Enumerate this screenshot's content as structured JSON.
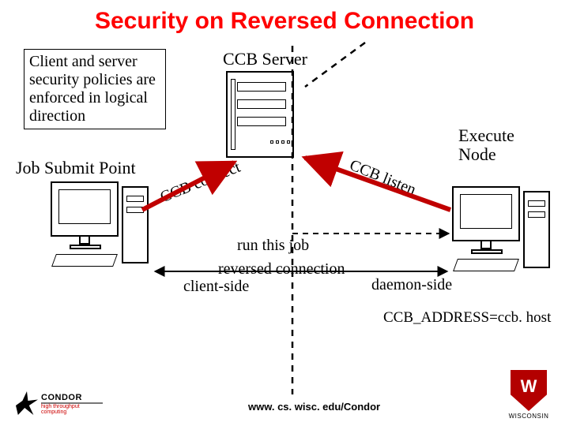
{
  "title": "Security on Reversed Connection",
  "note": "Client and server security policies are enforced in logical direction",
  "ccb_server": "CCB Server",
  "job_submit": "Job Submit Point",
  "execute_node_l1": "Execute",
  "execute_node_l2": "Node",
  "ccb_connect": "CCB connect",
  "ccb_listen": "CCB listen",
  "run_job": "run this job",
  "reversed_connection": "reversed connection",
  "client_side": "client-side",
  "daemon_side": "daemon-side",
  "ccb_address": "CCB_ADDRESS=ccb. host",
  "footer_url": "www. cs. wisc. edu/Condor",
  "condor_name": "CONDOR",
  "condor_tag": "high throughput computing",
  "uw_name": "WISCONSIN"
}
